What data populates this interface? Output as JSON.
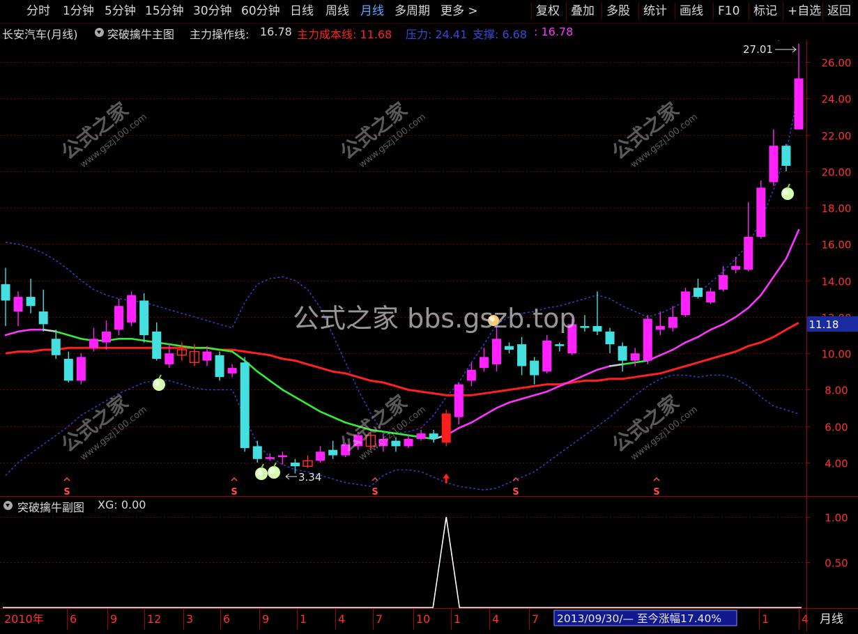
{
  "toolbar": {
    "periods": [
      "分时",
      "1分钟",
      "5分钟",
      "15分钟",
      "30分钟",
      "60分钟",
      "日线",
      "周线",
      "月线",
      "多周期",
      "更多 >"
    ],
    "active_period": "月线",
    "right_buttons": [
      "复权",
      "叠加",
      "多股",
      "统计",
      "画线",
      "F10",
      "标记",
      "+自选",
      "返回"
    ]
  },
  "info": {
    "stock": "长安汽车(月线)",
    "indicator": "突破擒牛主图",
    "main_line_label": "主力操作线:",
    "main_line_value": "16.78",
    "cost_line": "主力成本线: 11.68",
    "pressure": "压力: 24.41",
    "support": "支撑: 6.68",
    "extra": ": 16.78"
  },
  "sub": {
    "title": "突破擒牛副图",
    "xg": "XG: 0.00"
  },
  "watermark": "公式之家 bbs.gszb.top",
  "watermark_diag": "公式之家",
  "watermark_url": "www.gszj100.com",
  "current_price_tag": "11.18",
  "max_label": "27.01",
  "min_label": "3.34",
  "bottom": {
    "year_label": "2010年",
    "month_ticks": [
      "6",
      "9",
      "12",
      "3",
      "6",
      "9",
      "1",
      "4",
      "7",
      "10",
      "1",
      "4",
      "7",
      "1",
      "4"
    ],
    "range_text": "2013/09/30/— 至今涨幅17.40%",
    "period_label": "月线"
  },
  "colors": {
    "up": "#ff22ff",
    "down": "#44e0e0",
    "cost_line": "#ff2020",
    "main_line_green": "#33ee33",
    "main_line_magenta": "#ff33ff",
    "band": "#2d3dbf",
    "grid": "#7a0000"
  },
  "chart_data": {
    "type": "candlestick",
    "y_ticks": [
      "26.00",
      "24.00",
      "22.00",
      "20.00",
      "18.00",
      "16.00",
      "14.00",
      "12.00",
      "10.00",
      "8.00",
      "6.00",
      "4.00"
    ],
    "ylim": [
      2.9,
      27.5
    ],
    "sub_y_ticks": [
      "1.00",
      "0.50"
    ],
    "candles": [
      [
        12.9,
        13.8,
        11.5,
        14.7,
        0
      ],
      [
        12.3,
        13.1,
        11.5,
        13.4,
        1
      ],
      [
        13.1,
        12.6,
        12.2,
        14.1,
        0
      ],
      [
        12.3,
        11.6,
        11.2,
        13.5,
        0
      ],
      [
        10.8,
        9.9,
        9.7,
        11.3,
        0
      ],
      [
        9.7,
        8.5,
        8.4,
        10.1,
        0
      ],
      [
        8.5,
        9.8,
        8.3,
        10.0,
        1
      ],
      [
        10.3,
        10.8,
        10.1,
        11.4,
        1
      ],
      [
        10.6,
        11.2,
        10.2,
        11.8,
        1
      ],
      [
        11.3,
        12.6,
        11.0,
        13.0,
        1
      ],
      [
        11.7,
        13.2,
        11.5,
        13.4,
        1
      ],
      [
        12.9,
        11.0,
        10.6,
        13.3,
        0
      ],
      [
        11.2,
        9.7,
        9.6,
        11.7,
        0
      ],
      [
        9.4,
        10.0,
        9.2,
        10.5,
        1
      ],
      [
        9.9,
        10.2,
        9.6,
        10.6,
        1
      ],
      [
        10.1,
        9.5,
        9.3,
        10.5,
        0
      ],
      [
        9.6,
        10.1,
        9.3,
        10.4,
        1
      ],
      [
        9.9,
        8.7,
        8.5,
        10.1,
        0
      ],
      [
        8.9,
        9.2,
        8.7,
        9.4,
        1
      ],
      [
        9.5,
        4.8,
        4.6,
        9.8,
        0
      ],
      [
        4.9,
        4.2,
        4.0,
        5.2,
        0
      ],
      [
        4.2,
        4.3,
        4.1,
        4.5,
        1
      ],
      [
        4.3,
        4.4,
        3.9,
        4.6,
        1
      ],
      [
        4.0,
        3.8,
        3.4,
        4.2,
        0
      ],
      [
        3.8,
        4.1,
        3.7,
        4.4,
        1
      ],
      [
        4.1,
        4.6,
        4.0,
        4.9,
        1
      ],
      [
        4.7,
        4.4,
        4.2,
        5.2,
        0
      ],
      [
        4.4,
        5.0,
        4.3,
        5.1,
        1
      ],
      [
        4.9,
        5.5,
        4.7,
        5.7,
        1
      ],
      [
        5.5,
        4.9,
        4.7,
        5.7,
        0
      ],
      [
        4.9,
        5.3,
        4.6,
        5.6,
        1
      ],
      [
        5.2,
        4.9,
        4.6,
        5.4,
        0
      ],
      [
        4.9,
        5.3,
        4.8,
        5.5,
        1
      ],
      [
        5.3,
        5.6,
        5.2,
        5.8,
        1
      ],
      [
        5.6,
        5.3,
        5.1,
        5.8,
        0
      ],
      [
        5.1,
        6.7,
        4.9,
        6.9,
        1
      ],
      [
        6.5,
        8.3,
        6.1,
        8.4,
        1
      ],
      [
        8.5,
        9.1,
        8.2,
        9.5,
        1
      ],
      [
        9.2,
        9.8,
        9.0,
        10.3,
        1
      ],
      [
        9.4,
        10.8,
        9.0,
        11.5,
        1
      ],
      [
        10.4,
        10.2,
        10.0,
        10.6,
        0
      ],
      [
        10.5,
        9.3,
        8.8,
        10.9,
        0
      ],
      [
        9.6,
        8.8,
        8.3,
        9.8,
        0
      ],
      [
        9.0,
        10.7,
        8.9,
        11.0,
        1
      ],
      [
        10.5,
        10.4,
        10.1,
        10.6,
        0
      ],
      [
        10.0,
        11.6,
        9.9,
        11.9,
        1
      ],
      [
        11.5,
        11.4,
        11.2,
        12.1,
        0
      ],
      [
        11.5,
        11.2,
        11.0,
        13.4,
        0
      ],
      [
        11.2,
        10.5,
        10.0,
        11.4,
        0
      ],
      [
        10.4,
        9.6,
        9.0,
        10.6,
        0
      ],
      [
        9.6,
        10.0,
        9.3,
        10.3,
        1
      ],
      [
        9.6,
        11.9,
        9.4,
        12.1,
        1
      ],
      [
        11.3,
        11.5,
        11.0,
        12.3,
        1
      ],
      [
        11.4,
        12.0,
        11.2,
        12.6,
        1
      ],
      [
        12.1,
        13.4,
        12.0,
        13.6,
        1
      ],
      [
        13.6,
        13.1,
        13.0,
        14.1,
        0
      ],
      [
        12.8,
        13.4,
        12.7,
        13.6,
        1
      ],
      [
        13.5,
        14.3,
        13.4,
        14.8,
        1
      ],
      [
        14.6,
        14.8,
        14.4,
        15.3,
        1
      ],
      [
        14.6,
        16.4,
        14.5,
        18.3,
        1
      ],
      [
        16.4,
        19.1,
        16.3,
        19.5,
        1
      ],
      [
        19.4,
        21.4,
        19.2,
        22.3,
        1
      ],
      [
        21.4,
        20.3,
        20.0,
        21.5,
        0
      ],
      [
        22.3,
        25.1,
        22.3,
        27.01,
        1
      ]
    ],
    "ma_line": [
      11.0,
      11.2,
      11.3,
      11.3,
      11.2,
      11.0,
      10.8,
      10.7,
      10.7,
      10.8,
      10.8,
      10.7,
      10.6,
      10.5,
      10.4,
      10.3,
      10.3,
      10.2,
      10.1,
      9.6,
      9.0,
      8.5,
      8.0,
      7.6,
      7.2,
      6.8,
      6.5,
      6.2,
      6.0,
      5.8,
      5.7,
      5.6,
      5.5,
      5.4,
      5.3,
      5.5,
      5.9,
      6.2,
      6.6,
      7.0,
      7.3,
      7.5,
      7.7,
      7.9,
      8.2,
      8.5,
      8.8,
      9.1,
      9.3,
      9.4,
      9.5,
      9.6,
      9.9,
      10.2,
      10.6,
      10.9,
      11.3,
      11.6,
      12.0,
      12.5,
      13.2,
      14.2,
      15.2,
      16.78
    ],
    "cost_line": [
      10.0,
      10.1,
      10.1,
      10.2,
      10.2,
      10.3,
      10.3,
      10.3,
      10.3,
      10.3,
      10.3,
      10.3,
      10.3,
      10.3,
      10.3,
      10.3,
      10.3,
      10.2,
      10.2,
      10.1,
      10.0,
      9.9,
      9.7,
      9.6,
      9.4,
      9.2,
      9.0,
      8.9,
      8.7,
      8.5,
      8.4,
      8.2,
      8.0,
      7.9,
      7.8,
      7.7,
      7.7,
      7.7,
      7.8,
      7.9,
      8.0,
      8.1,
      8.2,
      8.3,
      8.3,
      8.4,
      8.5,
      8.5,
      8.6,
      8.6,
      8.7,
      8.8,
      8.9,
      9.1,
      9.3,
      9.5,
      9.7,
      9.9,
      10.1,
      10.4,
      10.6,
      10.9,
      11.3,
      11.68
    ],
    "upper_band": [
      16.1,
      16.0,
      15.8,
      15.5,
      15.1,
      14.6,
      14.0,
      13.5,
      13.2,
      13.0,
      12.9,
      12.8,
      12.6,
      12.4,
      12.2,
      12.0,
      11.8,
      11.6,
      11.4,
      12.8,
      13.8,
      14.1,
      14.2,
      14.0,
      13.5,
      12.5,
      11.0,
      9.5,
      8.0,
      6.7,
      5.6,
      5.6,
      5.7,
      5.9,
      6.6,
      7.6,
      8.4,
      9.5,
      10.5,
      11.6,
      12.0,
      12.2,
      12.3,
      12.5,
      12.6,
      12.8,
      13.0,
      13.2,
      13.0,
      12.6,
      12.3,
      12.0,
      12.2,
      12.5,
      12.9,
      13.3,
      13.9,
      14.5,
      15.2,
      16.0,
      17.3,
      19.0,
      21.0,
      24.41
    ],
    "lower_band": [
      3.3,
      4.0,
      4.5,
      5.0,
      5.5,
      6.0,
      6.6,
      7.0,
      7.4,
      7.8,
      8.1,
      8.4,
      8.5,
      8.5,
      8.3,
      8.1,
      8.0,
      8.0,
      8.0,
      6.5,
      5.0,
      4.3,
      3.9,
      3.6,
      3.5,
      3.3,
      3.1,
      2.9,
      2.8,
      2.7,
      3.3,
      3.6,
      3.6,
      3.5,
      3.2,
      2.9,
      2.7,
      2.6,
      2.5,
      2.6,
      2.9,
      3.2,
      3.5,
      4.0,
      4.5,
      5.0,
      5.5,
      6.0,
      6.5,
      7.1,
      7.7,
      8.2,
      8.6,
      8.8,
      8.8,
      8.7,
      8.8,
      8.8,
      8.6,
      8.2,
      7.6,
      7.1,
      6.9,
      6.68
    ],
    "buy_signal_index": 35,
    "s_marker_indices": [
      5,
      19,
      31,
      43,
      55
    ],
    "apple_indices": [
      12,
      22,
      23,
      62
    ],
    "sun_index": 40,
    "xg_values_nonzero_index": 35
  }
}
